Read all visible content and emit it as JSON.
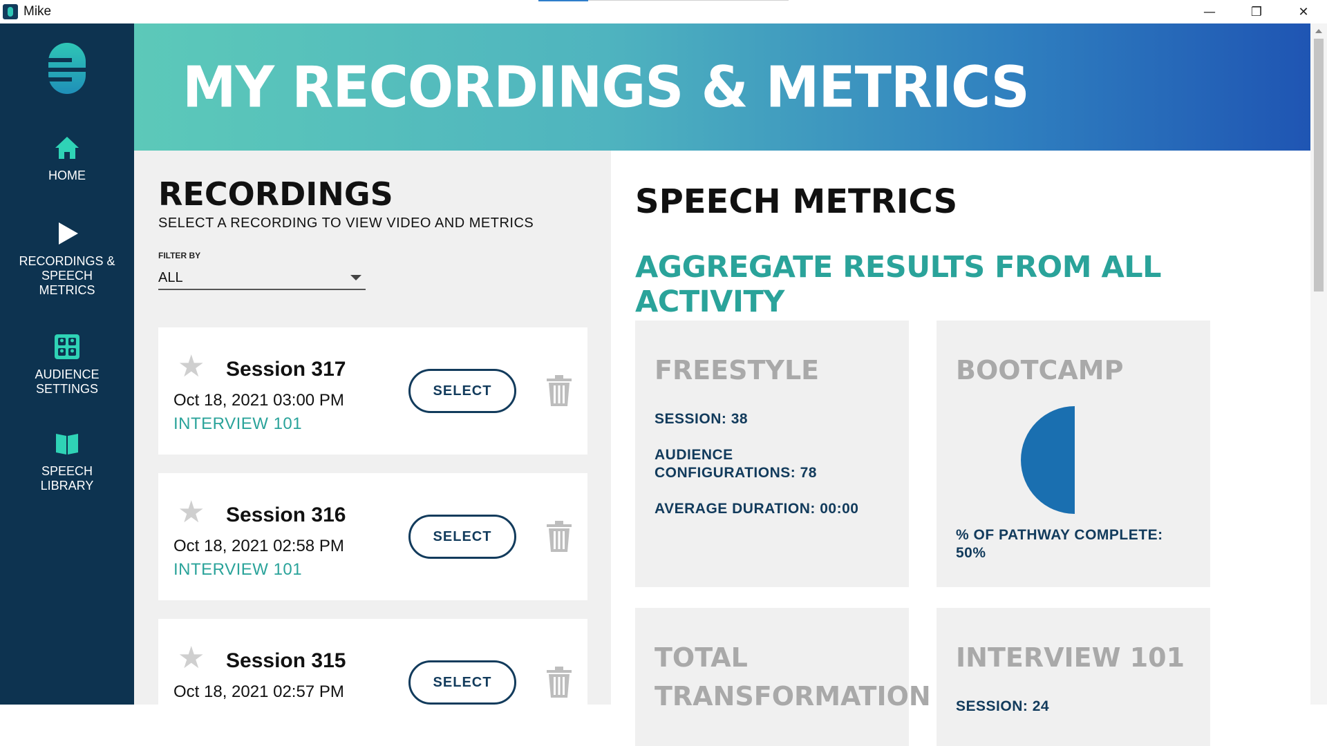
{
  "window": {
    "title": "Mike",
    "minimize": "—",
    "restore": "❐",
    "close": "✕"
  },
  "sidebar": {
    "items": [
      {
        "label": "HOME",
        "icon": "home-icon"
      },
      {
        "label": "RECORDINGS & SPEECH METRICS",
        "icon": "play-icon"
      },
      {
        "label": "AUDIENCE SETTINGS",
        "icon": "audience-grid-icon"
      },
      {
        "label": "SPEECH LIBRARY",
        "icon": "book-icon"
      }
    ]
  },
  "header": {
    "title": "MY RECORDINGS & METRICS"
  },
  "recordings": {
    "title": "RECORDINGS",
    "subtitle": "SELECT A RECORDING TO VIEW VIDEO AND METRICS",
    "filter_label": "FILTER BY",
    "filter_value": "ALL",
    "select_label": "SELECT",
    "items": [
      {
        "session": "Session 317",
        "date": "Oct 18, 2021 03:00 PM",
        "tag": "INTERVIEW 101"
      },
      {
        "session": "Session 316",
        "date": "Oct 18, 2021 02:58 PM",
        "tag": "INTERVIEW 101"
      },
      {
        "session": "Session 315",
        "date": "Oct 18, 2021 02:57 PM",
        "tag": ""
      }
    ]
  },
  "metrics": {
    "title": "SPEECH METRICS",
    "aggregate": "AGGREGATE RESULTS FROM ALL ACTIVITY",
    "freestyle": {
      "title": "FREESTYLE",
      "session": "SESSION: 38",
      "audience": "AUDIENCE CONFIGURATIONS: 78",
      "duration": "AVERAGE DURATION: 00:00"
    },
    "bootcamp": {
      "title": "BOOTCAMP",
      "pathway": "% OF PATHWAY COMPLETE: 50%",
      "percent_complete": 50
    },
    "total": {
      "title": "TOTAL TRANSFORMATION"
    },
    "interview": {
      "title": "INTERVIEW 101",
      "session_partial": "SESSION: 24"
    }
  },
  "colors": {
    "sidebar": "#0d3350",
    "accent_teal": "#2aa39a",
    "button_navy": "#123b5c",
    "pie_blue": "#1a6fb0"
  }
}
